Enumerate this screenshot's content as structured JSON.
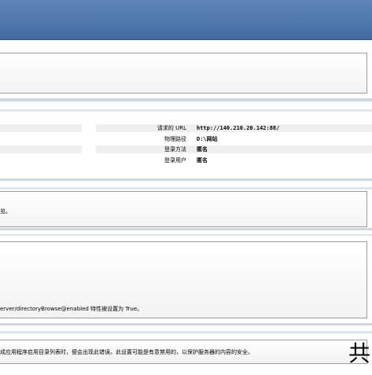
{
  "details": {
    "rows": [
      {
        "label": "请求的 URL",
        "value": "http://140.210.20.142:88/"
      },
      {
        "label": "物理路径",
        "value": "D:\\网站"
      },
      {
        "label": "登录方法",
        "value": "匿名"
      },
      {
        "label": "登录用户",
        "value": "匿名"
      }
    ]
  },
  "section_text": {
    "cause_fragment": "览。",
    "config_fragment": "erver/directoryBrowse@enabled 特性被设置为 True。",
    "more_info_fragment": "成应用程序启用目录列表时，便会出现此错误。此设置可能是有意禁用的，以保护服务器的内容的安全。"
  },
  "corner_glyph": "共"
}
